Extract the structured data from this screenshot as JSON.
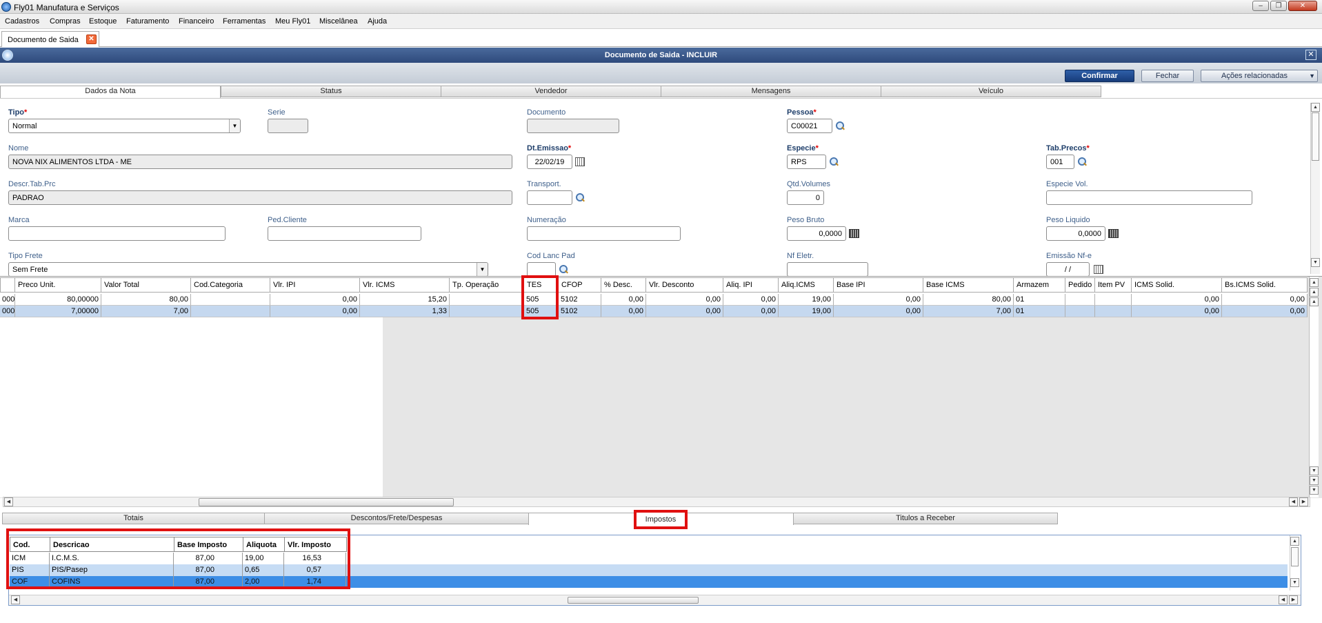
{
  "window": {
    "title": "Fly01 Manufatura e Serviços"
  },
  "menu": [
    "Cadastros",
    "Compras",
    "Estoque",
    "Faturamento",
    "Financeiro",
    "Ferramentas",
    "Meu Fly01",
    "Miscelânea",
    "Ajuda"
  ],
  "doc_tab": {
    "label": "Documento de Saida"
  },
  "dialog": {
    "title": "Documento de Saida - INCLUIR"
  },
  "toolbar": {
    "confirm": "Confirmar",
    "close": "Fechar",
    "related": "Ações relacionadas"
  },
  "top_tabs": [
    "Dados da Nota",
    "Status",
    "Vendedor",
    "Mensagens",
    "Veículo"
  ],
  "form": {
    "tipo_label": "Tipo",
    "tipo_value": "Normal",
    "serie_label": "Serie",
    "serie_value": "",
    "documento_label": "Documento",
    "documento_value": "",
    "pessoa_label": "Pessoa",
    "pessoa_value": "C00021",
    "nome_label": "Nome",
    "nome_value": "NOVA NIX ALIMENTOS LTDA - ME",
    "dtemissao_label": "Dt.Emissao",
    "dtemissao_value": "22/02/19",
    "especie_label": "Especie",
    "especie_value": "RPS",
    "tabprecos_label": "Tab.Precos",
    "tabprecos_value": "001",
    "descrtab_label": "Descr.Tab.Prc",
    "descrtab_value": "PADRAO",
    "transport_label": "Transport.",
    "transport_value": "",
    "qtdvol_label": "Qtd.Volumes",
    "qtdvol_value": "0",
    "especievol_label": "Especie Vol.",
    "especievol_value": "",
    "marca_label": "Marca",
    "marca_value": "",
    "pedcliente_label": "Ped.Cliente",
    "pedcliente_value": "",
    "numeracao_label": "Numeração",
    "numeracao_value": "",
    "pesobruto_label": "Peso Bruto",
    "pesobruto_value": "0,0000",
    "pesoliquido_label": "Peso Liquido",
    "pesoliquido_value": "0,0000",
    "tipofrete_label": "Tipo Frete",
    "tipofrete_value": "Sem Frete",
    "codlanc_label": "Cod Lanc Pad",
    "codlanc_value": "",
    "nfeletr_label": "Nf Eletr.",
    "nfeletr_value": "",
    "emissaonfe_label": "Emissão Nf-e",
    "emissaonfe_value": "/ /"
  },
  "items_grid": {
    "headers": [
      "Preco Unit.",
      "Valor Total",
      "Cod.Categoria",
      "Vlr. IPI",
      "Vlr. ICMS",
      "Tp. Operação",
      "TES",
      "CFOP",
      "% Desc.",
      "Vlr. Desconto",
      "Aliq. IPI",
      "Aliq.ICMS",
      "Base IPI",
      "Base ICMS",
      "Armazem",
      "Pedido",
      "Item PV",
      "ICMS Solid.",
      "Bs.ICMS Solid."
    ],
    "rows": [
      {
        "lead": "000",
        "preco": "80,00000",
        "total": "80,00",
        "cat": "",
        "ipi": "0,00",
        "icms": "15,20",
        "tpop": "",
        "tes": "505",
        "cfop": "5102",
        "desc": "0,00",
        "vdesc": "0,00",
        "aipi": "0,00",
        "aicms": "19,00",
        "bipi": "0,00",
        "bicms": "80,00",
        "arm": "01",
        "ped": "",
        "itpv": "",
        "icmssol": "0,00",
        "bssol": "0,00"
      },
      {
        "lead": "000",
        "preco": "7,00000",
        "total": "7,00",
        "cat": "",
        "ipi": "0,00",
        "icms": "1,33",
        "tpop": "",
        "tes": "505",
        "cfop": "5102",
        "desc": "0,00",
        "vdesc": "0,00",
        "aipi": "0,00",
        "aicms": "19,00",
        "bipi": "0,00",
        "bicms": "7,00",
        "arm": "01",
        "ped": "",
        "itpv": "",
        "icmssol": "0,00",
        "bssol": "0,00"
      }
    ]
  },
  "bottom_tabs": [
    "Totais",
    "Descontos/Frete/Despesas",
    "Impostos",
    "Titulos a Receber"
  ],
  "taxes": {
    "headers": [
      "Cod.",
      "Descricao",
      "Base Imposto",
      "Aliquota",
      "Vlr. Imposto"
    ],
    "rows": [
      {
        "cod": "ICM",
        "desc": "I.C.M.S.",
        "base": "87,00",
        "aliq": "19,00",
        "vlr": "16,53"
      },
      {
        "cod": "PIS",
        "desc": "PIS/Pasep",
        "base": "87,00",
        "aliq": "0,65",
        "vlr": "0,57"
      },
      {
        "cod": "COF",
        "desc": "COFINS",
        "base": "87,00",
        "aliq": "2,00",
        "vlr": "1,74"
      }
    ]
  },
  "colors": {
    "highlight_box": "#e01010",
    "header_blue": "#2e4a7c",
    "selected_row": "#c5d8ef",
    "selected_row_strong": "#3d8ee6"
  }
}
